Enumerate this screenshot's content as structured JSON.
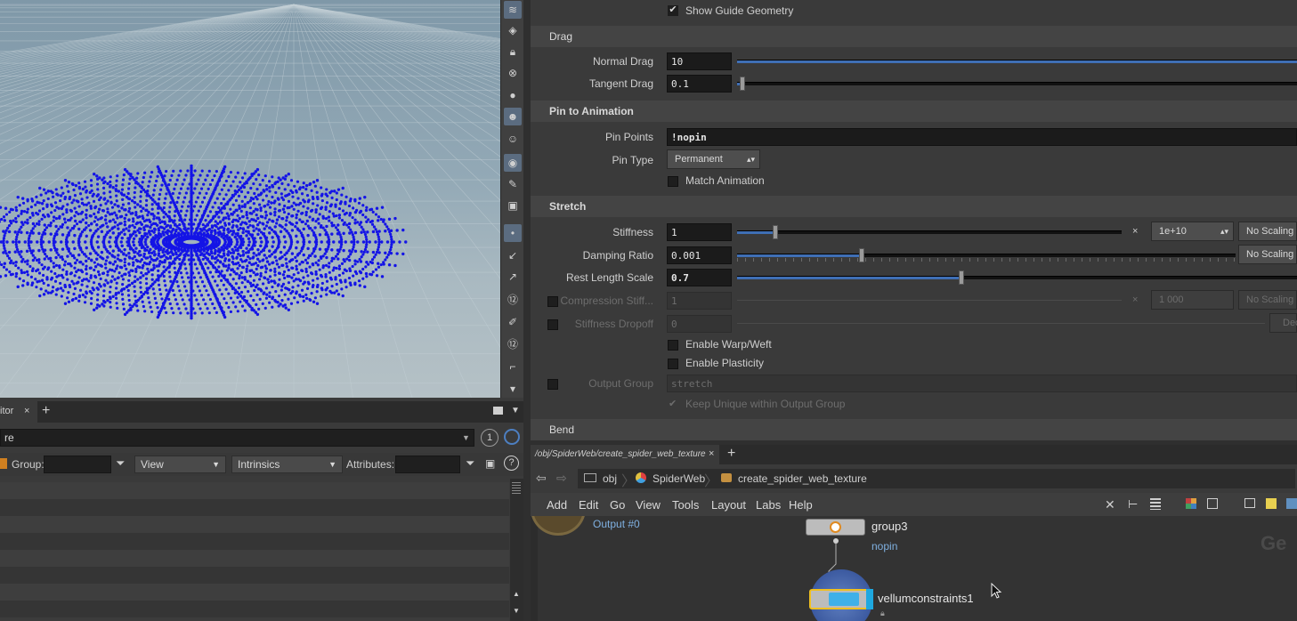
{
  "colors": {
    "accent": "#3f6fb5",
    "node_selected": "#f0c020",
    "node_label": "#7fb0e0",
    "web_points": "#1414e6"
  },
  "params": {
    "show_guide_geometry": {
      "label": "Show Guide Geometry",
      "checked": true
    },
    "drag": {
      "header": "Drag",
      "normal_drag": {
        "label": "Normal Drag",
        "value": "10",
        "fraction": 1.0
      },
      "tangent_drag": {
        "label": "Tangent Drag",
        "value": "0.1",
        "fraction": 0.01
      }
    },
    "pin": {
      "header": "Pin to Animation",
      "pin_points": {
        "label": "Pin Points",
        "value": "!nopin"
      },
      "pin_type": {
        "label": "Pin Type",
        "value": "Permanent"
      },
      "match_animation": {
        "label": "Match Animation",
        "checked": false
      }
    },
    "stretch": {
      "header": "Stretch",
      "stiffness": {
        "label": "Stiffness",
        "value": "1",
        "fraction": 0.1,
        "mult_symbol": "×",
        "mult_value": "1e+10",
        "scaling": "No Scaling"
      },
      "damping": {
        "label": "Damping Ratio",
        "value": "0.001",
        "fraction": 0.25,
        "scaling": "No Scaling"
      },
      "rest_length": {
        "label": "Rest Length Scale",
        "value": "0.7",
        "fraction": 0.4
      },
      "compression": {
        "label": "Compression Stiff...",
        "value": "1",
        "mult_symbol": "×",
        "mult_value": "1 000",
        "scaling": "No Scaling"
      },
      "dropoff": {
        "label": "Stiffness Dropoff",
        "value": "0",
        "scaling": "Dec"
      },
      "warp_weft": {
        "label": "Enable Warp/Weft",
        "checked": false
      },
      "plasticity": {
        "label": "Enable Plasticity",
        "checked": false
      },
      "output_group": {
        "label": "Output Group",
        "value": "stretch"
      },
      "keep_unique": {
        "label": "Keep Unique within Output Group",
        "checked": true
      }
    },
    "bend_header": "Bend"
  },
  "sheet": {
    "tab_label": "itor",
    "tab_close": "×",
    "tab_add": "+",
    "path_value": "re",
    "counter": "1",
    "group_label": "Group:",
    "view_label": "View",
    "intrinsics_label": "Intrinsics",
    "attributes_label": "Attributes:",
    "help": "?"
  },
  "network": {
    "tab_path": "/obj/SpiderWeb/create_spider_web_texture",
    "tab_close": "×",
    "tab_add": "+",
    "crumbs": [
      "obj",
      "SpiderWeb",
      "create_spider_web_texture"
    ],
    "menu": [
      "Add",
      "Edit",
      "Go",
      "View",
      "Tools",
      "Layout",
      "Labs",
      "Help"
    ],
    "output_label": "Output #0",
    "nodes": [
      {
        "name": "group3",
        "sublabel": "nopin"
      },
      {
        "name": "vellumconstraints1"
      }
    ],
    "watermark": "Ge"
  }
}
